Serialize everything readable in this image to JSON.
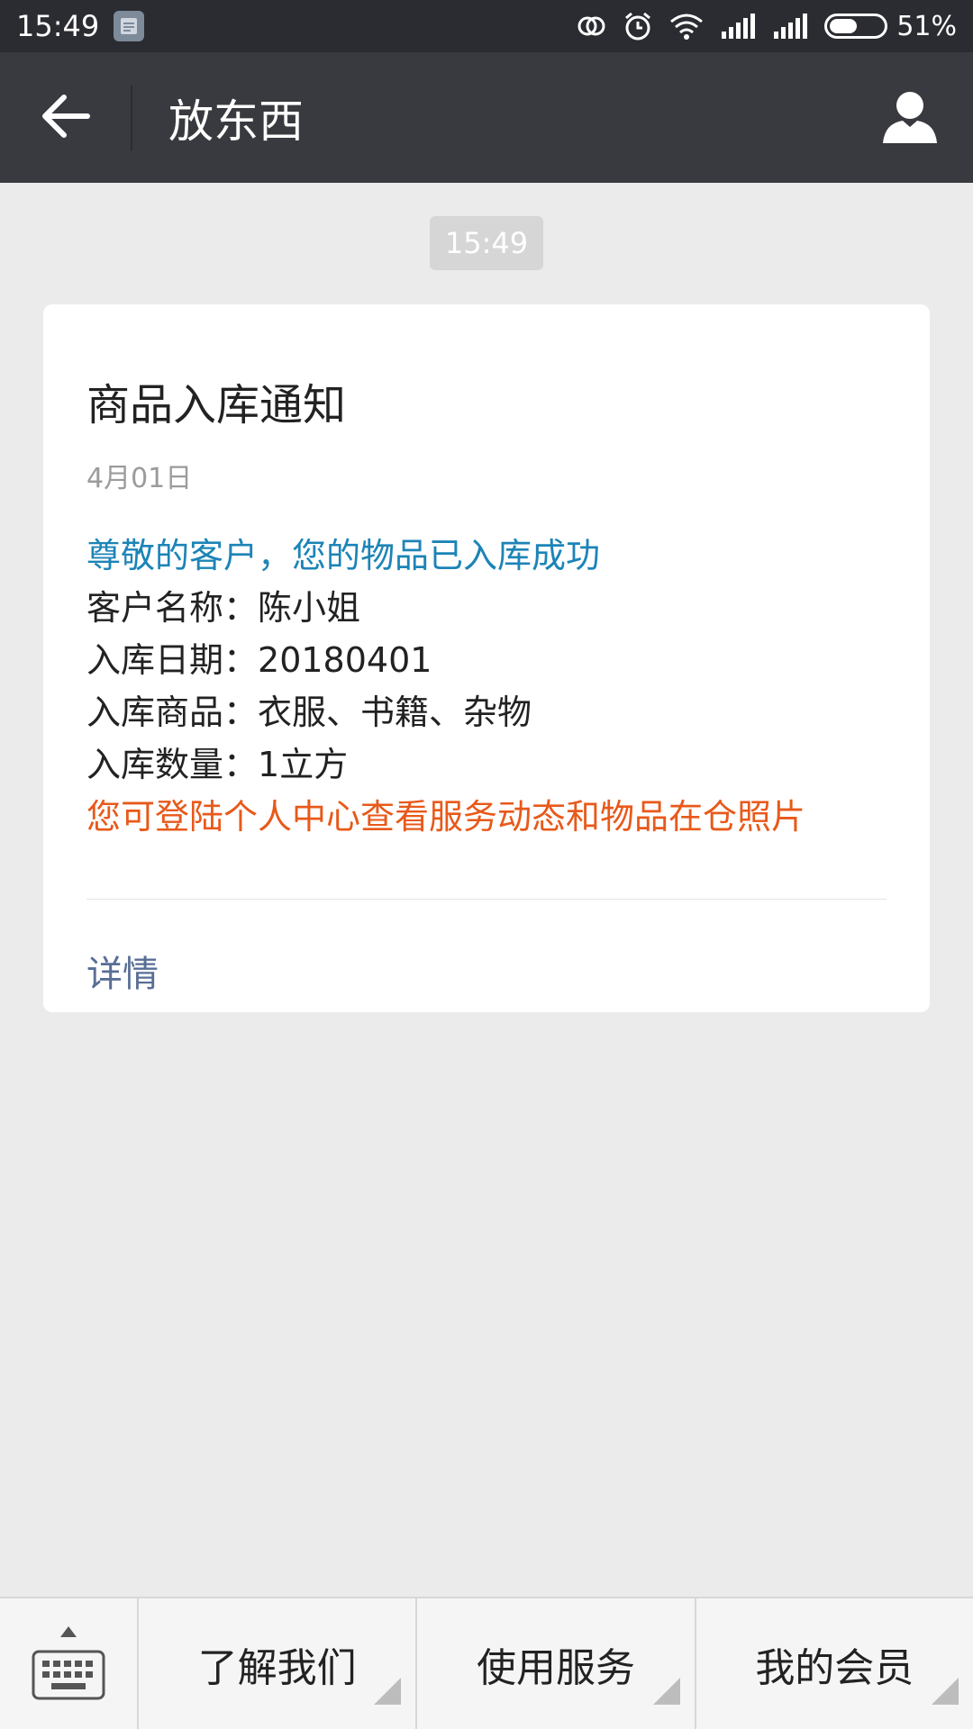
{
  "status_bar": {
    "time": "15:49",
    "battery_percent": 51,
    "battery_text": "51%",
    "icons": [
      "notification-icon",
      "sync-icon",
      "alarm-icon",
      "wifi-icon",
      "signal-icon",
      "signal-icon",
      "battery-icon"
    ]
  },
  "title_bar": {
    "title": "放东西",
    "back_icon": "arrow-left-icon",
    "profile_icon": "user-icon"
  },
  "chat": {
    "timestamp": "15:49",
    "message": {
      "title": "商品入库通知",
      "date": "4月01日",
      "greeting": "尊敬的客户，您的物品已入库成功",
      "fields": [
        {
          "label": "客户名称：",
          "value": "陈小姐"
        },
        {
          "label": "入库日期：",
          "value": "20180401"
        },
        {
          "label": "入库商品：",
          "value": "衣服、书籍、杂物"
        },
        {
          "label": "入库数量：",
          "value": "1立方"
        }
      ],
      "note": "您可登陆个人中心查看服务动态和物品在仓照片",
      "details_label": "详情"
    }
  },
  "bottom_menu": {
    "keyboard_icon": "keyboard-icon",
    "items": [
      {
        "label": "了解我们"
      },
      {
        "label": "使用服务"
      },
      {
        "label": "我的会员"
      }
    ]
  },
  "colors": {
    "status_bar_bg": "#2b2c31",
    "title_bar_bg": "#393a3f",
    "background": "#ebebeb",
    "greeting_text": "#1c84b7",
    "note_text": "#e8591a",
    "link_text": "#586e95"
  }
}
